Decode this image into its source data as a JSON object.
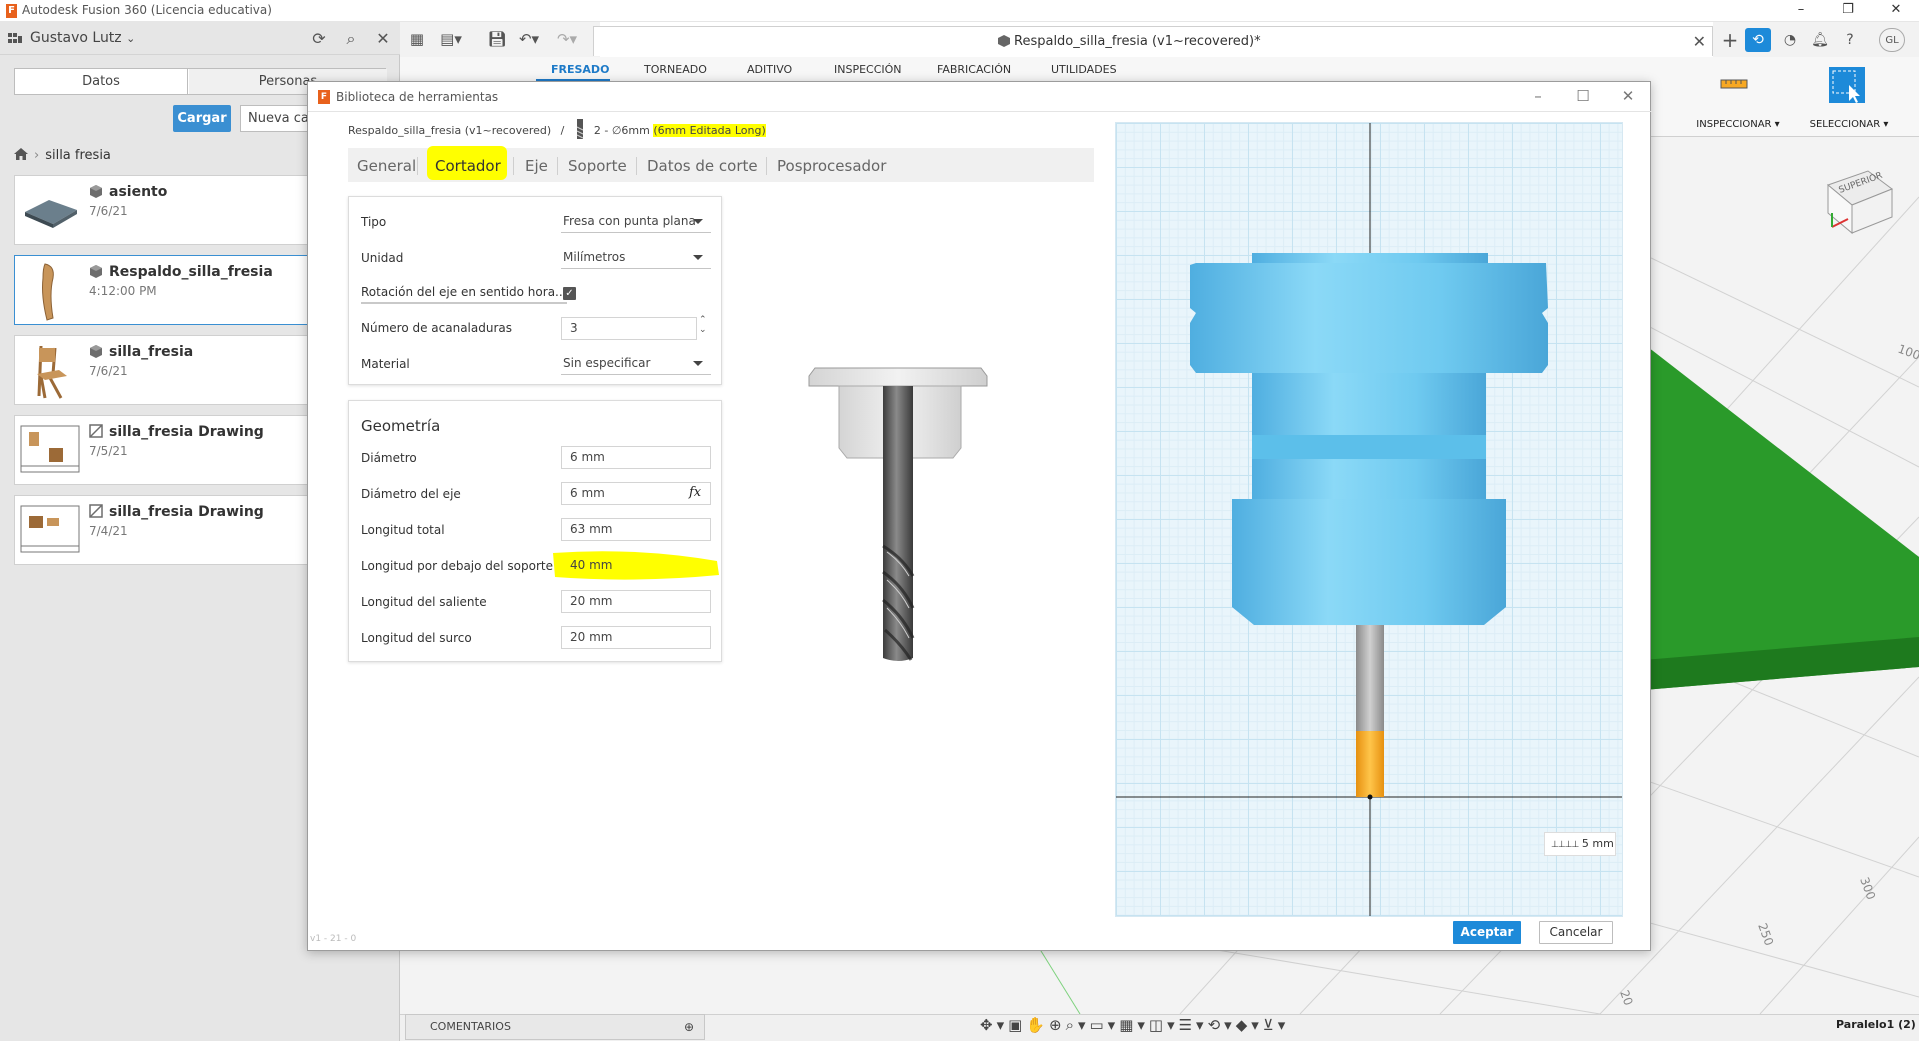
{
  "app": {
    "title": "Autodesk Fusion 360 (Licencia educativa)",
    "logo_letter": "F"
  },
  "data_panel": {
    "user": "Gustavo Lutz",
    "tabs": [
      "Datos",
      "Personas"
    ],
    "upload_label": "Cargar",
    "new_folder_label": "Nueva carpeta",
    "breadcrumb": "silla fresia",
    "files": [
      {
        "name": "asiento",
        "date": "7/6/21",
        "type": "design"
      },
      {
        "name": "Respaldo_silla_fresia",
        "date": "4:12:00 PM",
        "type": "design"
      },
      {
        "name": "silla_fresia",
        "date": "7/6/21",
        "type": "design"
      },
      {
        "name": "silla_fresia Drawing",
        "date": "7/5/21",
        "type": "drawing"
      },
      {
        "name": "silla_fresia Drawing",
        "date": "7/4/21",
        "type": "drawing"
      }
    ]
  },
  "document": {
    "title": "Respaldo_silla_fresia (v1~recovered)*"
  },
  "ribbon": {
    "tabs": [
      "FRESADO",
      "TORNEADO",
      "ADITIVO",
      "INSPECCIÓN",
      "FABRICACIÓN",
      "UTILIDADES"
    ],
    "active_tab": "FRESADO",
    "groups": [
      "INSPECCIONAR ▾",
      "SELECCIONAR ▾"
    ]
  },
  "user_initials": "GL",
  "viewcube": {
    "face": "SUPERIOR"
  },
  "viewport": {
    "axis_labels": [
      "100",
      "300",
      "250",
      "20"
    ],
    "comments_label": "COMENTARIOS",
    "browser_label": "Paralelo1 (2)"
  },
  "dialog": {
    "title": "Biblioteca de herramientas",
    "path_doc": "Respaldo_silla_fresia (v1~recovered)",
    "path_sep": "/",
    "path_tool": "2 - ∅6mm",
    "path_tool_name": "(6mm Editada Long)",
    "tabs": [
      "General",
      "Cortador",
      "Eje",
      "Soporte",
      "Datos de corte",
      "Posprocesador"
    ],
    "active_tab": "Cortador",
    "cutter": {
      "type_label": "Tipo",
      "type_value": "Fresa con punta plana",
      "unit_label": "Unidad",
      "unit_value": "Milímetros",
      "clockwise_label": "Rotación del eje en sentido hora...",
      "clockwise_checked": true,
      "flutes_label": "Número de acanaladuras",
      "flutes_value": "3",
      "material_label": "Material",
      "material_value": "Sin especificar"
    },
    "geometry": {
      "heading": "Geometría",
      "fx_label": "fx",
      "fields": [
        {
          "label": "Diámetro",
          "value": "6 mm"
        },
        {
          "label": "Diámetro del eje",
          "value": "6 mm"
        },
        {
          "label": "Longitud total",
          "value": "63 mm"
        },
        {
          "label": "Longitud por debajo del soporte",
          "value": "40 mm"
        },
        {
          "label": "Longitud del saliente",
          "value": "20 mm"
        },
        {
          "label": "Longitud del surco",
          "value": "20 mm"
        }
      ]
    },
    "scale_label": "5 mm",
    "status": "v1 - 21 - 0",
    "accept_label": "Aceptar",
    "cancel_label": "Cancelar"
  },
  "colors": {
    "accent": "#1d8ad9",
    "holder": "#6fcaf0",
    "stickout": "#f7a823",
    "highlight": "#ffff00",
    "stock": "#2a9a2a"
  }
}
